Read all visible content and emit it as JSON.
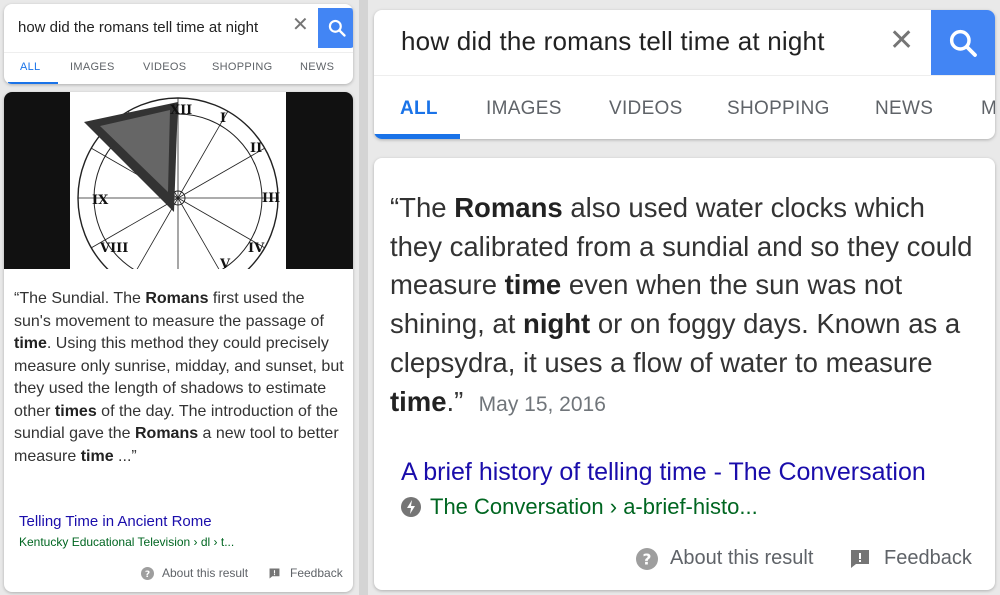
{
  "search": {
    "query": "how did the romans tell time at night",
    "clear_glyph": "✕",
    "tabs": [
      "ALL",
      "IMAGES",
      "VIDEOS",
      "SHOPPING",
      "NEWS"
    ],
    "right_extra_tab": "M",
    "accent": "#4285f4"
  },
  "left_result": {
    "image": "sundial-icon",
    "snippet_html": "“The Sundial. The <b>Romans</b> first used the sun's movement to measure the passage of <b>time</b>. Using this method they could precisely measure only sunrise, midday, and sunset, but they used the length of shadows to estimate other <b>times</b> of the day. The introduction of the sundial gave the <b>Romans</b> a new tool to better measure <b>time</b> ...”",
    "link_title": "Telling Time in Ancient Rome",
    "cite": "Kentucky Educational Television › dl › t...",
    "about": "About this result",
    "feedback": "Feedback"
  },
  "right_result": {
    "snippet_html": "“The <b>Romans</b> also used water clocks which they calibrated from a sundial and so they could measure <b>time</b> even when the sun was not shining, at <b>night</b> or on foggy days. Known as a clepsydra, it uses a flow of water to measure <b>time</b>.”",
    "date": "May 15, 2016",
    "link_title": "A brief history of telling time - The Conversation",
    "cite": "The Conversation › a-brief-histo...",
    "about": "About this result",
    "feedback": "Feedback"
  }
}
